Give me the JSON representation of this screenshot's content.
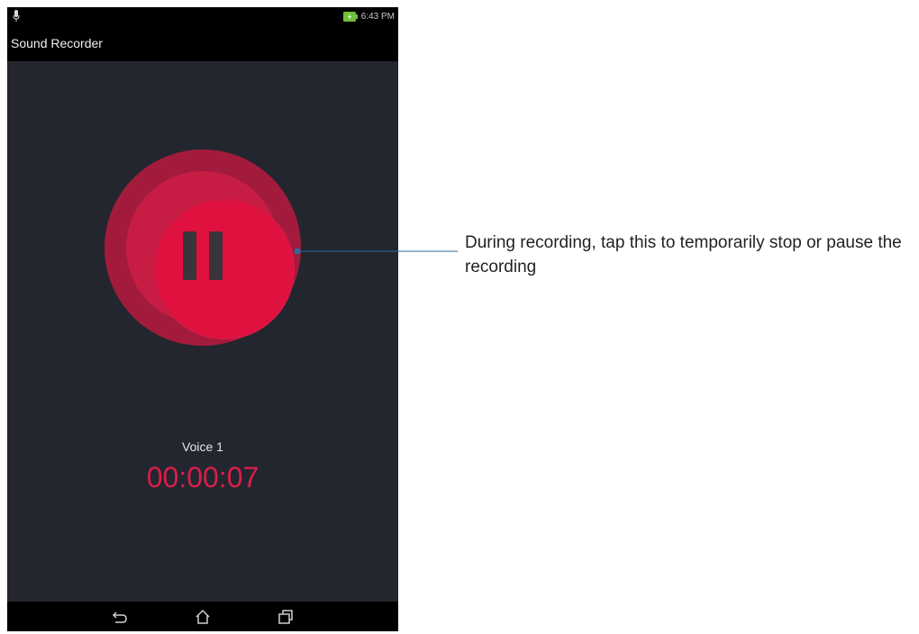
{
  "status_bar": {
    "left_icon": "mic-icon",
    "battery_icon": "battery-charging-icon",
    "time": "6:43 PM"
  },
  "app_bar": {
    "title": "Sound Recorder"
  },
  "recorder": {
    "control_icon": "pause-icon",
    "recording_name": "Voice 1",
    "elapsed_time": "00:00:07"
  },
  "nav_bar": {
    "back_icon": "back-icon",
    "home_icon": "home-icon",
    "recent_icon": "recent-apps-icon"
  },
  "callout": {
    "text": "During recording, tap this to temporarily stop or pause the recording"
  },
  "colors": {
    "screen_background": "#23262e",
    "bars": "#000000",
    "accent_red": "#e0103f",
    "timer_red": "#d81e4a",
    "callout_line": "#2b6a9a"
  }
}
